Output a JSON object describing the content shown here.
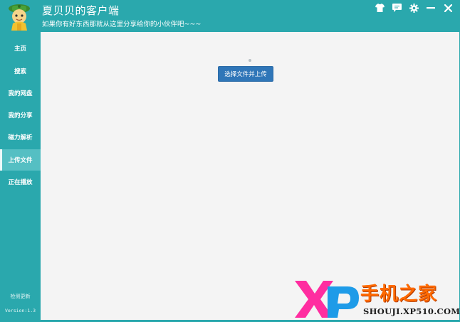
{
  "app": {
    "title": "夏贝贝的客户端",
    "subtitle": "如果你有好东西那就从这里分享给你的小伙伴吧~~~",
    "window_controls": [
      "shirt-icon",
      "message-icon",
      "gear-icon",
      "minimize-icon",
      "close-icon"
    ]
  },
  "sidebar": {
    "items": [
      {
        "label": "主页"
      },
      {
        "label": "搜索"
      },
      {
        "label": "我的网盘"
      },
      {
        "label": "我的分享"
      },
      {
        "label": "磁力解析"
      },
      {
        "label": "上传文件"
      },
      {
        "label": "正在播放"
      }
    ],
    "active_index": 5,
    "check_update": "检测更新",
    "version": "Version:1.3"
  },
  "main": {
    "upload_button_label": "选择文件并上传"
  },
  "watermark": {
    "logo_text": "XP",
    "brand_text": "手机之家",
    "url": "SHOUJI.XP510.COM"
  },
  "colors": {
    "teal": "#2aa8ad",
    "teal_active": "#55bfc3",
    "content_bg": "#f4f4f4",
    "button_blue": "#2f76b8",
    "watermark_orange": "#ff6a00",
    "watermark_pink": "#ff2da0",
    "watermark_blue": "#1e9be8"
  }
}
